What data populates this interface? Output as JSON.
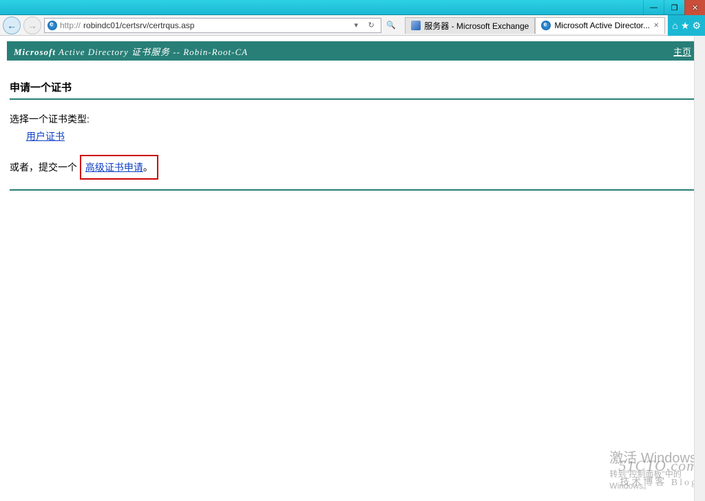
{
  "window": {
    "minimize": "—",
    "maximize": "❐",
    "close": "✕"
  },
  "nav": {
    "back": "←",
    "forward": "→",
    "url_prefix": "http://",
    "url": "robindc01/certsrv/certrqus.asp",
    "dropdown": "▾",
    "refresh": "↻",
    "search": "🔍"
  },
  "tabs": [
    {
      "label": "服务器 - Microsoft Exchange",
      "close": ""
    },
    {
      "label": "Microsoft Active Director...",
      "close": "✕"
    }
  ],
  "rightIcons": {
    "home": "⌂",
    "fav": "★",
    "gear": "⚙"
  },
  "header": {
    "brand_bold": "Microsoft",
    "brand_rest": " Active Directory 证书服务  --  Robin-Root-CA",
    "home": "主页"
  },
  "page": {
    "title": "申请一个证书",
    "select_type": "选择一个证书类型:",
    "user_cert": "用户证书",
    "or_submit": "或者，提交一个 ",
    "adv_request": "高级证书申请",
    "period": "。"
  },
  "watermark": {
    "title": "激活 Windows",
    "sub1": "转到\"控制面板\"中的",
    "sub2": "Windows。"
  },
  "blog": {
    "line1": "51CTO.com",
    "line2": "技术博客   Blog"
  }
}
